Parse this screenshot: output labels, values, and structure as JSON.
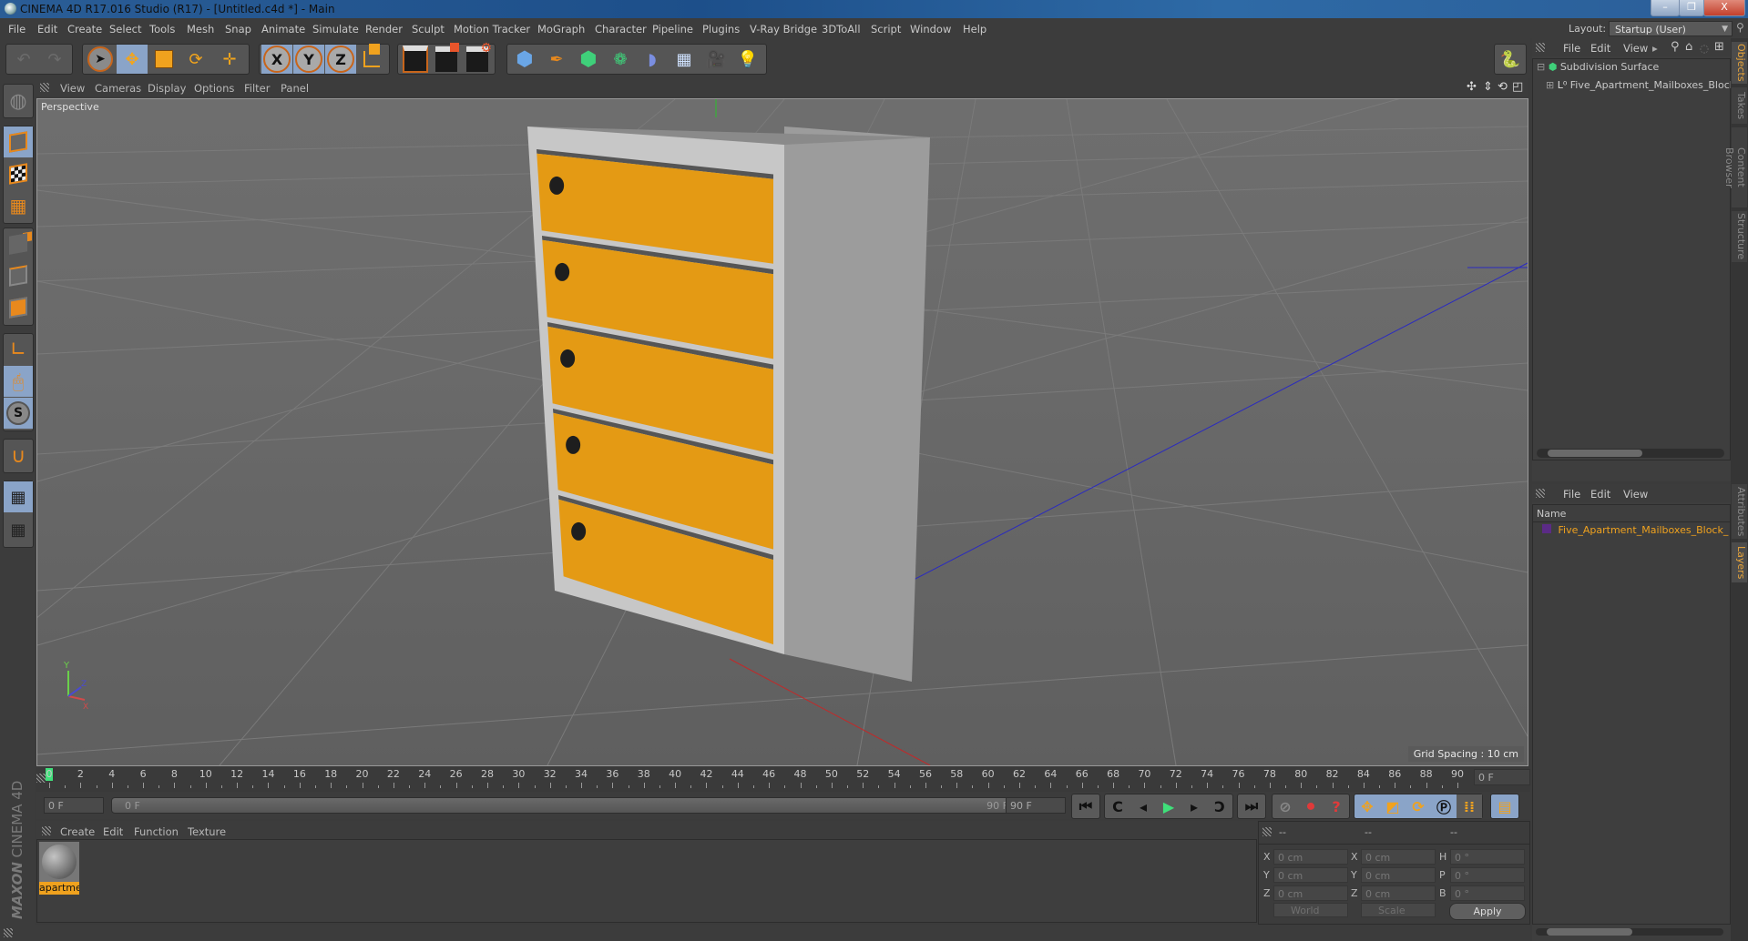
{
  "window": {
    "title": "CINEMA 4D R17.016 Studio (R17) - [Untitled.c4d *] - Main",
    "minimize_label": "–",
    "restore_label": "❐",
    "close_label": "X"
  },
  "menubar": {
    "items": [
      "File",
      "Edit",
      "Create",
      "Select",
      "Tools",
      "Mesh",
      "Snap",
      "Animate",
      "Simulate",
      "Render",
      "Sculpt",
      "Motion Tracker",
      "MoGraph",
      "Character",
      "Pipeline",
      "Plugins",
      "V-Ray Bridge",
      "3DToAll",
      "Script",
      "Window",
      "Help"
    ],
    "layout_label": "Layout:",
    "layout_value": "Startup (User)"
  },
  "toolbar": {
    "undo": "undo-icon",
    "redo": "redo-icon",
    "tools": [
      "live-selection",
      "move",
      "scale",
      "rotate",
      "move-axis"
    ],
    "axis_locks": [
      "X",
      "Y",
      "Z"
    ],
    "coord_system": "world-coordinate-icon",
    "render": [
      "render-view",
      "render-picture-viewer",
      "render-settings"
    ],
    "objects": [
      "cube",
      "pen-spline",
      "subdivision-surface",
      "array-cloner",
      "deformer-bend",
      "floor",
      "camera",
      "light"
    ]
  },
  "viewport": {
    "menu": [
      "View",
      "Cameras",
      "Display",
      "Options",
      "Filter",
      "Panel"
    ],
    "label": "Perspective",
    "grid_spacing": "Grid Spacing : 10 cm",
    "nav_icons": [
      "move-view-icon",
      "dolly-view-icon",
      "rotate-view-icon",
      "maximize-view-icon"
    ],
    "model": {
      "name": "Five_Apartment_Mailboxes_Block",
      "door_color": "#e49a14",
      "frame_color": "#c9c9c9",
      "door_count": 5
    }
  },
  "timeline": {
    "ticks": [
      0,
      2,
      4,
      6,
      8,
      10,
      12,
      14,
      16,
      18,
      20,
      22,
      24,
      26,
      28,
      30,
      32,
      34,
      36,
      38,
      40,
      42,
      44,
      46,
      48,
      50,
      52,
      54,
      56,
      58,
      60,
      62,
      64,
      66,
      68,
      70,
      72,
      74,
      76,
      78,
      80,
      82,
      84,
      86,
      88,
      90
    ],
    "current_frame": "0 F",
    "start_frame": "0 F",
    "range_start": "0 F",
    "range_end": "90 F",
    "end_frame": "90 F"
  },
  "materials": {
    "menu": [
      "Create",
      "Edit",
      "Function",
      "Texture"
    ],
    "items": [
      {
        "name": "apartme"
      }
    ]
  },
  "brand": {
    "maxon": "MAXON",
    "product": "CINEMA 4D"
  },
  "coordinates": {
    "headers": [
      "--",
      "--",
      "--"
    ],
    "position": [
      {
        "axis": "X",
        "value": "0 cm"
      },
      {
        "axis": "Y",
        "value": "0 cm"
      },
      {
        "axis": "Z",
        "value": "0 cm"
      }
    ],
    "size": [
      {
        "axis": "X",
        "value": "0 cm"
      },
      {
        "axis": "Y",
        "value": "0 cm"
      },
      {
        "axis": "Z",
        "value": "0 cm"
      }
    ],
    "rotation": [
      {
        "axis": "H",
        "value": "0 °"
      },
      {
        "axis": "P",
        "value": "0 °"
      },
      {
        "axis": "B",
        "value": "0 °"
      }
    ],
    "mode": "World",
    "transform": "Scale",
    "apply_label": "Apply"
  },
  "object_manager": {
    "menu": [
      "File",
      "Edit",
      "View"
    ],
    "objects": [
      {
        "name": "Subdivision Surface",
        "icon": "subdivision-surface-icon"
      },
      {
        "name": "Five_Apartment_Mailboxes_Block",
        "icon": "null-object-icon"
      }
    ]
  },
  "layer_manager": {
    "menu": [
      "File",
      "Edit",
      "View"
    ],
    "column": "Name",
    "layers": [
      {
        "name": "Five_Apartment_Mailboxes_Block_",
        "color": "#5b2b86"
      }
    ]
  },
  "side_tabs": {
    "top": [
      "Objects",
      "Takes",
      "Content Browser",
      "Structure"
    ],
    "bottom": [
      "Attributes",
      "Layers"
    ]
  }
}
